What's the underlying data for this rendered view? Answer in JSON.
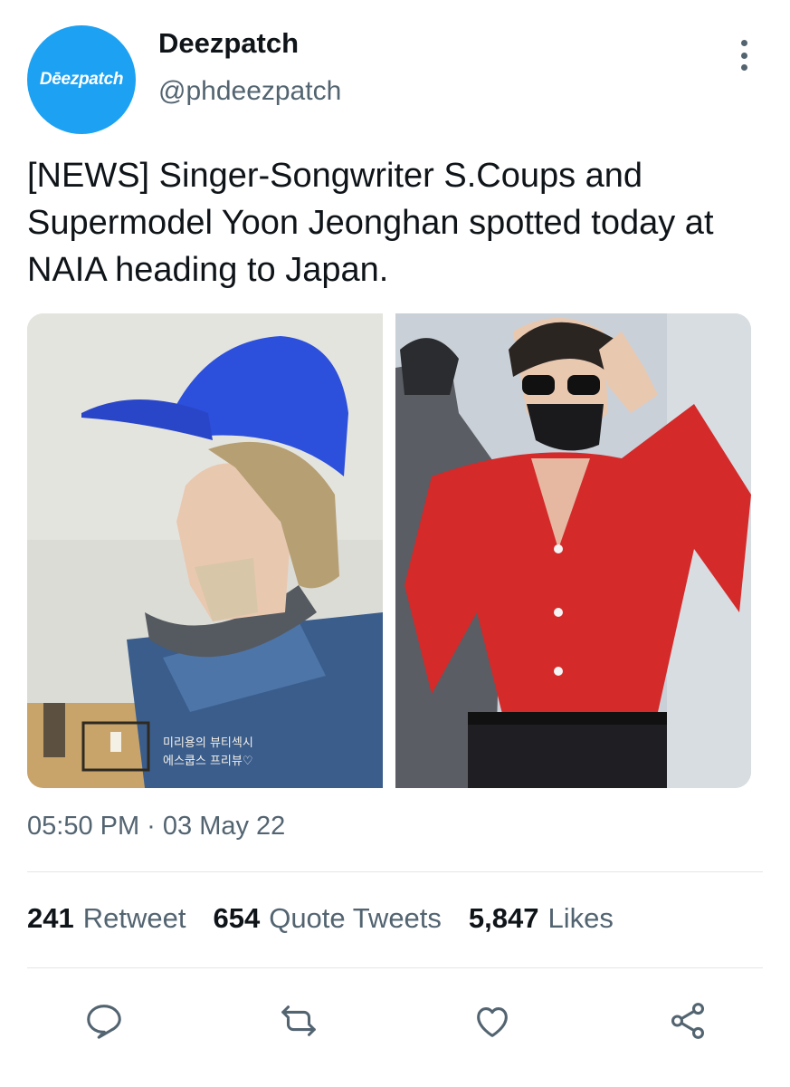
{
  "header": {
    "avatar_text": "Dēezpatch",
    "display_name": "Deezpatch",
    "handle": "@phdeezpatch",
    "more_icon": "more-vertical-icon"
  },
  "tweet": {
    "text": "[NEWS] Singer-Songwriter S.Coups and Supermodel Yoon Jeonghan spotted today at NAIA heading to Japan.",
    "photos": [
      {
        "alt": "Man in blue cap with mask on chin and headphones around neck, side profile"
      },
      {
        "alt": "Man in red cardigan, black mask and sunglasses making a hand gesture"
      }
    ],
    "timestamp": "05:50 PM · 03 May 22"
  },
  "stats": {
    "retweets": {
      "count": "241",
      "label": "Retweet"
    },
    "quotes": {
      "count": "654",
      "label": "Quote Tweets"
    },
    "likes": {
      "count": "5,847",
      "label": "Likes"
    }
  },
  "actions": [
    "reply-icon",
    "retweet-icon",
    "like-icon",
    "share-icon"
  ],
  "colors": {
    "accent": "#1da1f2",
    "muted_text": "#536471",
    "icon": "#536471"
  }
}
